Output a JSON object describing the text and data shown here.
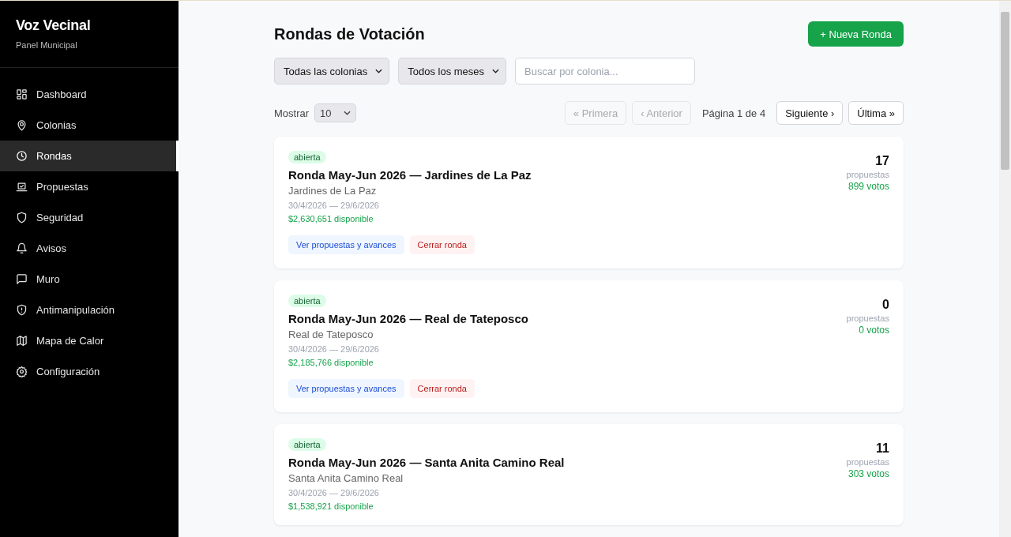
{
  "sidebar": {
    "brand": "Voz Vecinal",
    "subtitle": "Panel Municipal",
    "items": [
      {
        "label": "Dashboard",
        "selected": false
      },
      {
        "label": "Colonias",
        "selected": false
      },
      {
        "label": "Rondas",
        "selected": true
      },
      {
        "label": "Propuestas",
        "selected": false
      },
      {
        "label": "Seguridad",
        "selected": false
      },
      {
        "label": "Avisos",
        "selected": false
      },
      {
        "label": "Muro",
        "selected": false
      },
      {
        "label": "Antimanipulación",
        "selected": false
      },
      {
        "label": "Mapa de Calor",
        "selected": false
      },
      {
        "label": "Configuración",
        "selected": false
      }
    ]
  },
  "header": {
    "title": "Rondas de Votación",
    "new_button": "+ Nueva Ronda"
  },
  "filters": {
    "colonia": "Todas las colonias",
    "mes": "Todos los meses",
    "search": {
      "placeholder": "Buscar por colonia..."
    }
  },
  "pager": {
    "show_label": "Mostrar",
    "page_size": "10",
    "info": "Página 1 de 4",
    "buttons": [
      {
        "label": "« Primera",
        "disabled": true
      },
      {
        "label": "‹ Anterior",
        "disabled": true
      },
      {
        "label": "Siguiente ›",
        "disabled": false
      },
      {
        "label": "Última »",
        "disabled": false
      }
    ]
  },
  "rounds": [
    {
      "status": "abierta",
      "title": "Ronda May-Jun 2026 — Jardines de La Paz",
      "colonia": "Jardines de La Paz",
      "dates": "30/4/2026 — 29/6/2026",
      "budget": "$2,630,651 disponible",
      "count": "17",
      "count_label": "propuestas",
      "votes": "899 votos",
      "actions": [
        {
          "label": "Ver propuestas y avances",
          "kind": "primary"
        },
        {
          "label": "Cerrar ronda",
          "kind": "danger"
        }
      ]
    },
    {
      "status": "abierta",
      "title": "Ronda May-Jun 2026 — Real de Tateposco",
      "colonia": "Real de Tateposco",
      "dates": "30/4/2026 — 29/6/2026",
      "budget": "$2,185,766 disponible",
      "count": "0",
      "count_label": "propuestas",
      "votes": "0 votos",
      "actions": [
        {
          "label": "Ver propuestas y avances",
          "kind": "primary"
        },
        {
          "label": "Cerrar ronda",
          "kind": "danger"
        }
      ]
    },
    {
      "status": "abierta",
      "title": "Ronda May-Jun 2026 — Santa Anita Camino Real",
      "colonia": "Santa Anita Camino Real",
      "dates": "30/4/2026 — 29/6/2026",
      "budget": "$1,538,921 disponible",
      "count": "11",
      "count_label": "propuestas",
      "votes": "303 votos"
    }
  ]
}
